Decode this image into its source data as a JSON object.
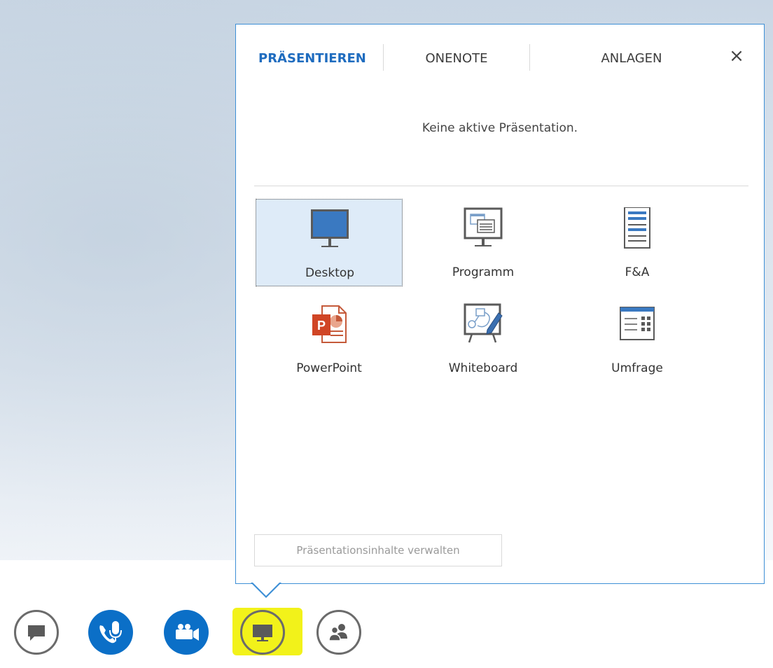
{
  "panel": {
    "tabs": [
      {
        "label": "PRÄSENTIEREN",
        "active": true
      },
      {
        "label": "ONENOTE",
        "active": false
      },
      {
        "label": "ANLAGEN",
        "active": false
      }
    ],
    "close_icon": "×",
    "status_text": "Keine aktive Präsentation.",
    "options": [
      {
        "label": "Desktop",
        "icon": "desktop-monitor-icon",
        "selected": true
      },
      {
        "label": "Programm",
        "icon": "program-window-icon",
        "selected": false
      },
      {
        "label": "F&A",
        "icon": "qa-document-icon",
        "selected": false
      },
      {
        "label": "PowerPoint",
        "icon": "powerpoint-icon",
        "selected": false
      },
      {
        "label": "Whiteboard",
        "icon": "whiteboard-icon",
        "selected": false
      },
      {
        "label": "Umfrage",
        "icon": "poll-icon",
        "selected": false
      }
    ],
    "manage_button": "Präsentationsinhalte verwalten"
  },
  "toolbar": {
    "buttons": [
      {
        "name": "chat",
        "icon": "chat-bubble-icon"
      },
      {
        "name": "call",
        "icon": "phone-mic-icon"
      },
      {
        "name": "video",
        "icon": "video-camera-icon"
      },
      {
        "name": "present",
        "icon": "monitor-icon",
        "highlighted": true
      },
      {
        "name": "participants",
        "icon": "people-icon"
      }
    ]
  },
  "colors": {
    "accent": "#1f6cbf",
    "panel_border": "#3d8fd6",
    "toolbar_blue": "#0b6fc7",
    "highlight": "#f2f21a",
    "selected_tile": "#deebf8"
  }
}
